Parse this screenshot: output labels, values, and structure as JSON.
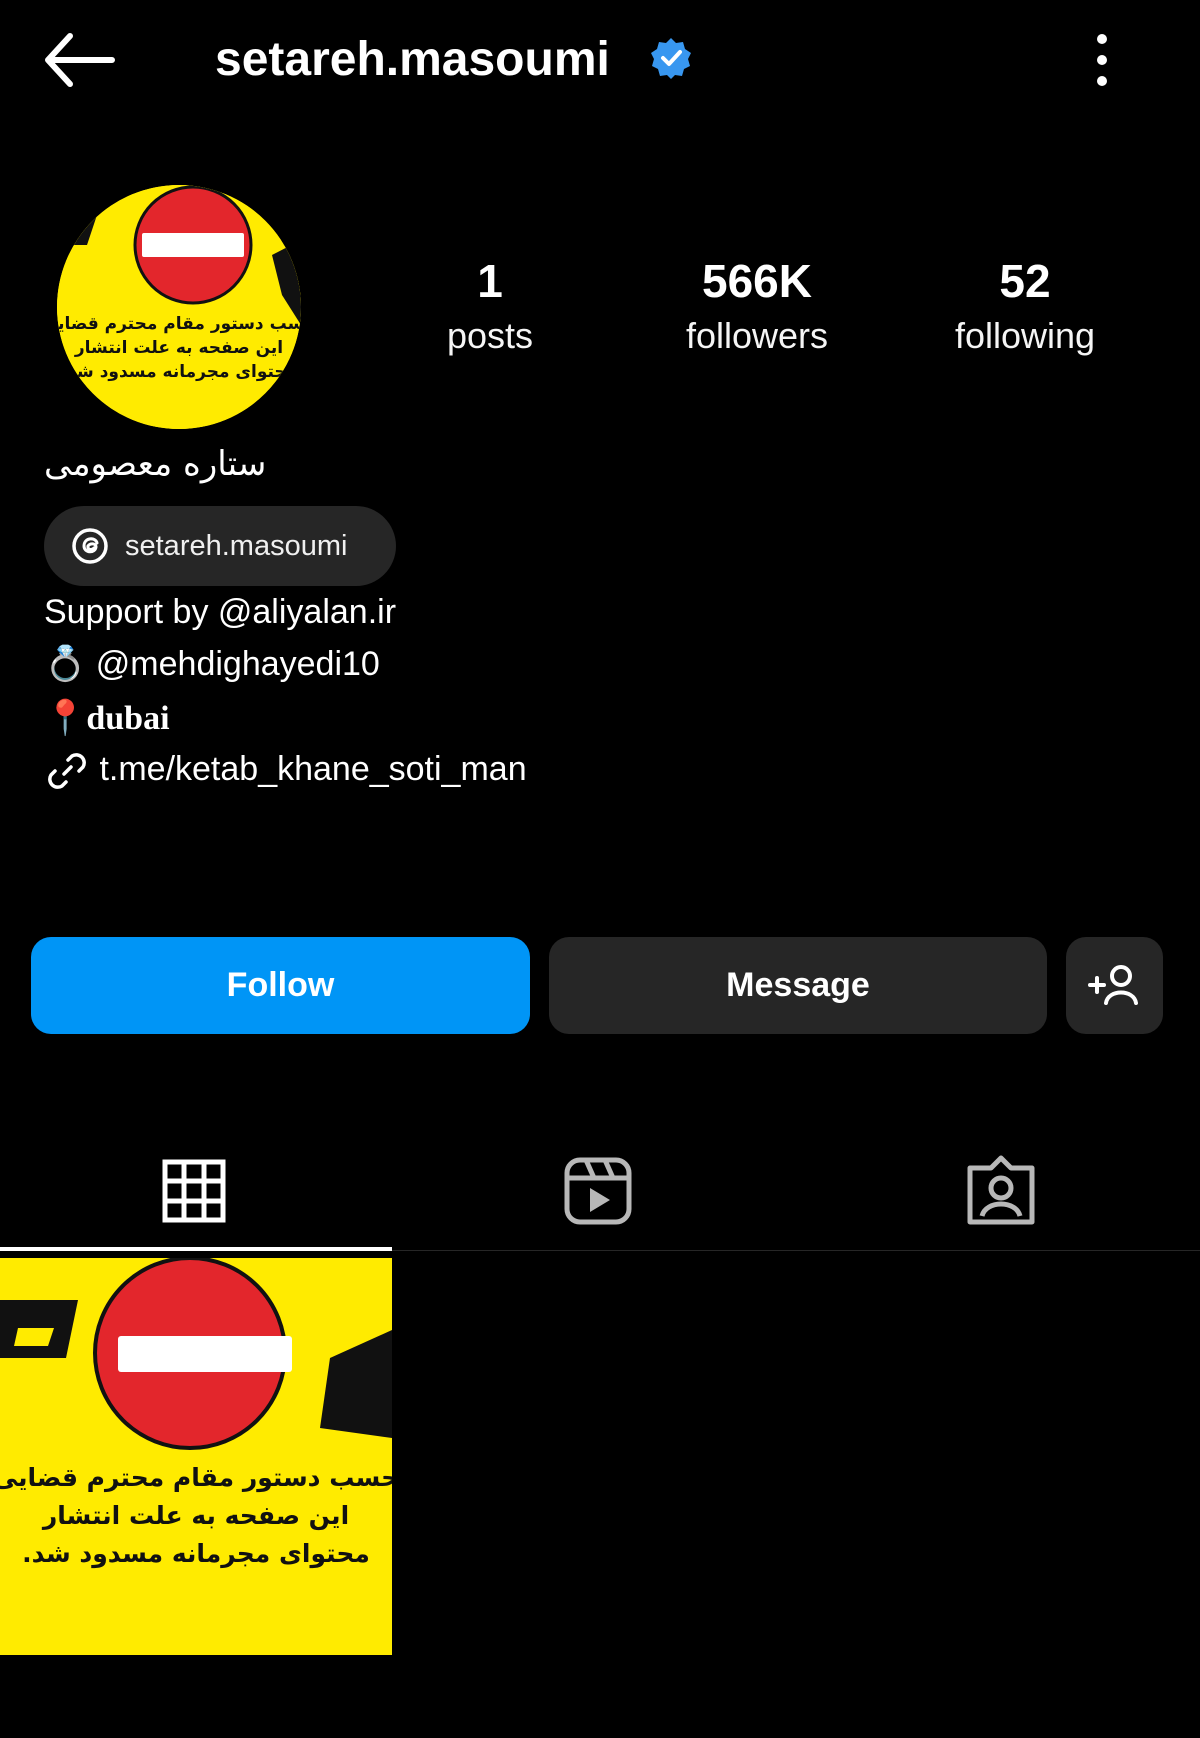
{
  "header": {
    "username": "setareh.masoumi",
    "verified_icon": "verified-badge-icon",
    "back_icon": "arrow-left-icon",
    "more_icon": "more-vertical-icon"
  },
  "profile": {
    "full_name": "ستاره معصومی",
    "avatar_text": {
      "line1": "حسب دستور مقام محترم قضایی",
      "line2": "این صفحه به علت انتشار",
      "line3": "محتوای مجرمانه مسدود شد."
    }
  },
  "stats": {
    "posts": {
      "value": "1",
      "label": "posts"
    },
    "followers": {
      "value": "566K",
      "label": "followers"
    },
    "following": {
      "value": "52",
      "label": "following"
    }
  },
  "threads": {
    "label": "setareh.masoumi",
    "icon": "threads-icon"
  },
  "bio": {
    "support": "Support by @aliyalan.ir",
    "partner_icon": "💍",
    "partner": "@mehdighayedi10",
    "location_icon": "📍",
    "location": "dubai",
    "link": "t.me/ketab_khane_soti_man"
  },
  "actions": {
    "follow": "Follow",
    "message": "Message",
    "add_user_icon": "add-user-icon"
  },
  "tabs": [
    {
      "name": "grid",
      "icon": "grid-icon",
      "active": true
    },
    {
      "name": "reels",
      "icon": "reels-icon",
      "active": false
    },
    {
      "name": "tagged",
      "icon": "tagged-icon",
      "active": false
    }
  ],
  "posts": [
    {
      "line1": "حسب دستور مقام محترم قضایی",
      "line2": "این صفحه به علت انتشار",
      "line3": "محتوای مجرمانه مسدود شد."
    }
  ],
  "colors": {
    "background": "#000000",
    "follow_button": "#0095f6",
    "secondary_button": "#262626",
    "verified": "#3897f0",
    "banner_yellow": "#ffeb00",
    "sign_red": "#e3262c"
  }
}
